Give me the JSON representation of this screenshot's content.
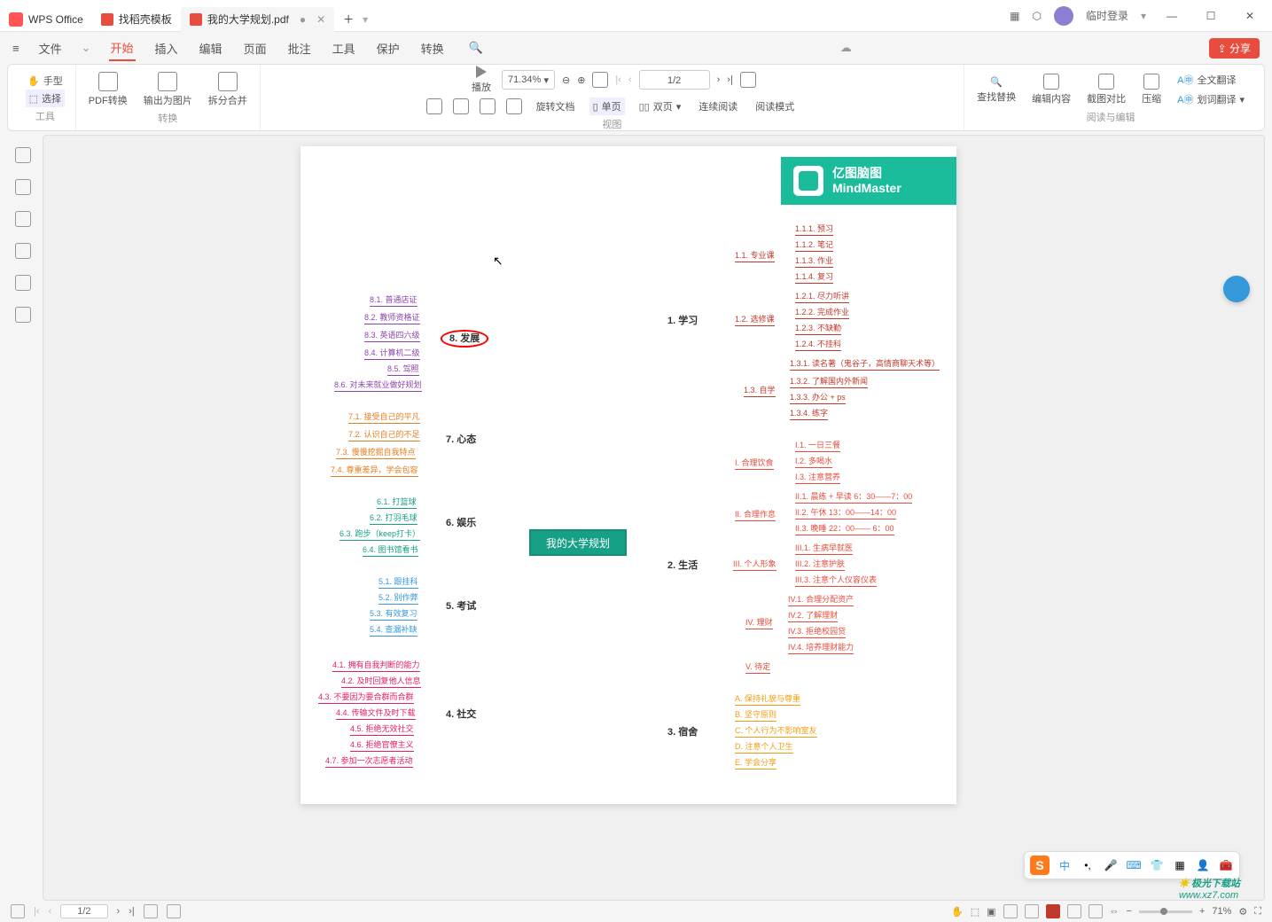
{
  "titlebar": {
    "app_name": "WPS Office",
    "tabs": [
      {
        "label": "找稻壳模板"
      },
      {
        "label": "我的大学规划.pdf",
        "active": true
      }
    ],
    "login": "临时登录"
  },
  "menubar": {
    "file": "文件",
    "items": [
      "开始",
      "插入",
      "编辑",
      "页面",
      "批注",
      "工具",
      "保护",
      "转换"
    ],
    "share": "分享"
  },
  "ribbon": {
    "tools": {
      "hand": "手型",
      "select": "选择",
      "group": "工具"
    },
    "convert": {
      "pdf_convert": "PDF转换",
      "export_img": "输出为图片",
      "split_merge": "拆分合并",
      "group": "转换"
    },
    "view": {
      "play": "播放",
      "zoom": "71.34%",
      "page": "1/2",
      "rotate": "旋转文档",
      "single": "单页",
      "double": "双页",
      "continuous": "连续阅读",
      "read_mode": "阅读模式",
      "group": "视图"
    },
    "edit": {
      "find_replace": "查找替换",
      "edit_content": "编辑内容",
      "compare": "截图对比",
      "compress": "压缩",
      "full_translate": "全文翻译",
      "word_translate": "划词翻译",
      "group": "阅读与编辑"
    }
  },
  "mindmap": {
    "brand_cn": "亿图脑图",
    "brand_en": "MindMaster",
    "center": "我的大学规划",
    "left": {
      "n8": {
        "label": "8. 发展",
        "items": [
          "8.1. 普通店证",
          "8.2. 教师资格证",
          "8.3. 英语四六级",
          "8.4. 计算机二级",
          "8.5. 驾照",
          "8.6. 对未来就业做好规划"
        ]
      },
      "n7": {
        "label": "7. 心态",
        "items": [
          "7.1. 接受自己的平凡",
          "7.2. 认识自己的不足",
          "7.3. 慢慢挖掘自我特点",
          "7.4. 尊重差异，学会包容"
        ]
      },
      "n6": {
        "label": "6. 娱乐",
        "items": [
          "6.1. 打篮球",
          "6.2. 打羽毛球",
          "6.3. 跑步（keep打卡）",
          "6.4. 图书馆看书"
        ]
      },
      "n5": {
        "label": "5. 考试",
        "items": [
          "5.1. 跟挂科",
          "5.2. 别作弊",
          "5.3. 有效复习",
          "5.4. 查漏补缺"
        ]
      },
      "n4": {
        "label": "4. 社交",
        "items": [
          "4.1. 拥有自我判断的能力",
          "4.2. 及时回复他人信息",
          "4.3. 不要因为要合群而合群",
          "4.4. 传输文件及时下载",
          "4.5. 拒绝无效社交",
          "4.6. 拒绝官僚主义",
          "4.7. 参加一次志愿者活动"
        ]
      }
    },
    "right": {
      "n1": {
        "label": "1. 学习",
        "sub": [
          {
            "label": "1.1. 专业课",
            "items": [
              "1.1.1. 预习",
              "1.1.2. 笔记",
              "1.1.3. 作业",
              "1.1.4. 复习"
            ]
          },
          {
            "label": "1.2. 选修课",
            "items": [
              "1.2.1. 尽力听讲",
              "1.2.2. 完成作业",
              "1.2.3. 不缺勤",
              "1.2.4. 不挂科"
            ]
          },
          {
            "label": "1.3. 自学",
            "items": [
              "1.3.1. 读名著（鬼谷子，高情商聊天术等）",
              "1.3.2. 了解国内外新闻",
              "1.3.3. 办公 + ps",
              "1.3.4. 练字"
            ]
          }
        ]
      },
      "n2": {
        "label": "2. 生活",
        "sub": [
          {
            "label": "I. 合理饮食",
            "items": [
              "I.1. 一日三餐",
              "I.2. 多喝水",
              "I.3. 注意营养"
            ]
          },
          {
            "label": "II. 合理作息",
            "items": [
              "II.1. 晨练 + 早读 6：30——7：00",
              "II.2. 午休 13：00——14：00",
              "II.3. 晚睡 22：00—— 6：00"
            ]
          },
          {
            "label": "III. 个人形象",
            "items": [
              "III.1. 生病早就医",
              "III.2. 注意护肤",
              "III.3. 注意个人仪容仪表"
            ]
          },
          {
            "label": "IV. 理财",
            "items": [
              "IV.1. 合理分配资产",
              "IV.2. 了解理财",
              "IV.3. 拒绝校园贷",
              "IV.4. 培养理财能力"
            ]
          },
          {
            "label": "V. 待定",
            "items": []
          }
        ]
      },
      "n3": {
        "label": "3. 宿舍",
        "items": [
          "A. 保持礼貌与尊重",
          "B. 坚守原则",
          "C. 个人行为不影响室友",
          "D. 注意个人卫生",
          "E. 学会分享"
        ]
      }
    }
  },
  "statusbar": {
    "page": "1/2",
    "zoom": "71%"
  },
  "float_tb": {
    "lang": "中"
  },
  "watermark": {
    "site": "极光下载站",
    "url": "www.xz7.com"
  }
}
